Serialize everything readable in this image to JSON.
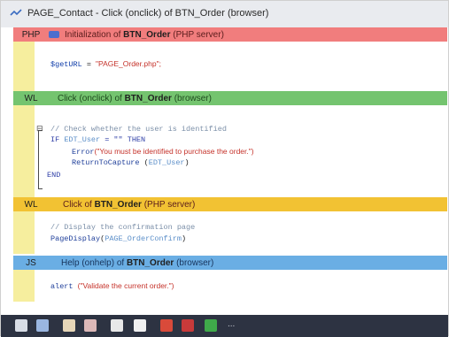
{
  "window": {
    "title": "PAGE_Contact - Click (onclick) of BTN_Order (browser)"
  },
  "sections": [
    {
      "tag": "PHP",
      "tag_extra": "",
      "text_pre": "Initialization of ",
      "text_bold": "BTN_Order",
      "text_post": " (PHP server)",
      "color": "#f17d7d"
    },
    {
      "tag": "WL",
      "text_pre": "Click (onclick) of ",
      "text_bold": "BTN_Order",
      "text_post": " (browser)",
      "color": "#74c46f"
    },
    {
      "tag": "WL",
      "text_pre": "Click of ",
      "text_bold": "BTN_Order",
      "text_post": " (PHP server)",
      "color": "#f2c233"
    },
    {
      "tag": "JS",
      "text_pre": "Help (onhelp) of ",
      "text_bold": "BTN_Order",
      "text_post": " (browser)",
      "color": "#6aaee4"
    }
  ],
  "code": {
    "php_line": {
      "var": "$getURL",
      "op": " = ",
      "str": "\"PAGE_Order.php\";"
    },
    "wl_comment": "// Check whether the user is identified",
    "if_kw": "IF",
    "if_ident": "EDT_User",
    "if_rest": " = \"\" THEN",
    "error_fn": "Error",
    "error_str": "(\"You must be identified to purchase the order.\")",
    "return_fn": "ReturnToCapture",
    "return_arg_open": " (",
    "return_ident": "EDT_User",
    "return_arg_close": ")",
    "end_kw": "END",
    "server_comment": "// Display the confirmation page",
    "page_fn": "PageDisplay",
    "page_open": "(",
    "page_ident": "PAGE_OrderConfirm",
    "page_close": ")",
    "js_fn": "alert",
    "js_str": "(\"Validate the current order.\")"
  },
  "taskbar": {
    "icons": [
      "app-icon-1",
      "app-icon-2",
      "app-icon-3",
      "app-icon-4",
      "app-icon-5",
      "app-icon-6",
      "app-icon-7",
      "app-icon-8",
      "app-icon-9"
    ],
    "more": "..."
  }
}
